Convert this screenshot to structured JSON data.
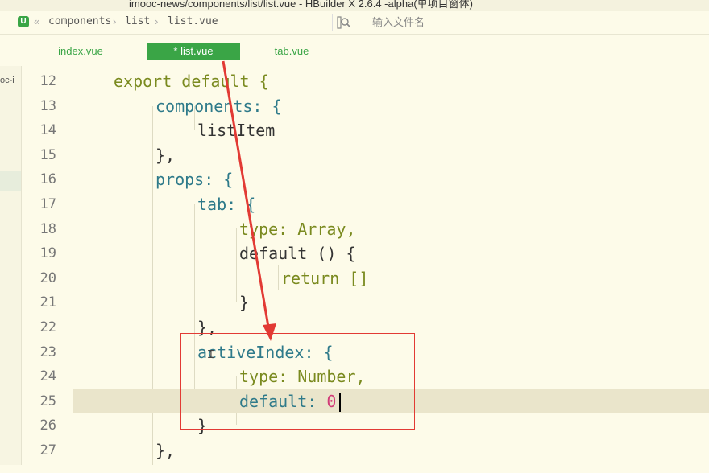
{
  "window": {
    "title": "imooc-news/components/list/list.vue - HBuilder X 2.6.4 -alpha(单项目窗体)"
  },
  "breadcrumb": {
    "root": "components",
    "folder": "list",
    "file": "list.vue"
  },
  "search": {
    "placeholder": "输入文件名"
  },
  "tabs": [
    {
      "label": "index.vue",
      "active": false
    },
    {
      "label": "* list.vue",
      "active": true
    },
    {
      "label": "tab.vue",
      "active": false
    }
  ],
  "sidebar": {
    "project_label": "oc-i"
  },
  "editor": {
    "lines": [
      {
        "num": "12",
        "code": "export default {"
      },
      {
        "num": "13",
        "code": "components: {"
      },
      {
        "num": "14",
        "code": "listItem"
      },
      {
        "num": "15",
        "code": "},"
      },
      {
        "num": "16",
        "code": "props: {"
      },
      {
        "num": "17",
        "code": "tab: {"
      },
      {
        "num": "18",
        "code": "type: Array,"
      },
      {
        "num": "19",
        "code": "default () {"
      },
      {
        "num": "20",
        "code": "return []"
      },
      {
        "num": "21",
        "code": "}"
      },
      {
        "num": "22",
        "code": "},"
      },
      {
        "num": "23",
        "code": "activeIndex: {"
      },
      {
        "num": "24",
        "code": "type: Number,"
      },
      {
        "num": "25",
        "code": "default: 0"
      },
      {
        "num": "26",
        "code": "}"
      },
      {
        "num": "27",
        "code": "},"
      }
    ],
    "current_line": "25"
  },
  "colors": {
    "accent": "#3aa546",
    "keyword": "#7a8a1f",
    "property": "#2e7a8a",
    "number": "#d23c78",
    "annotation": "#e23a34",
    "background": "#fdfbe9"
  }
}
